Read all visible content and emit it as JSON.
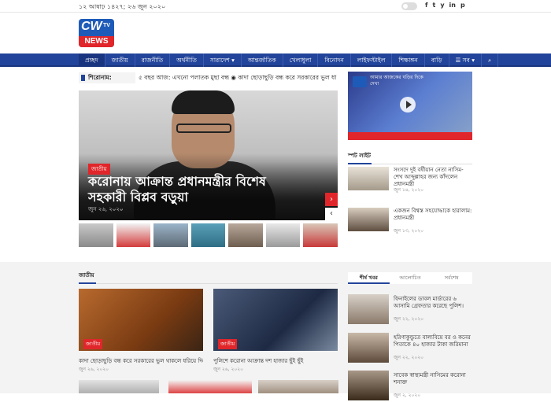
{
  "topbar": {
    "date": "১২ আষাঢ় ১৪২৭; ২৬ জুন ২০২০",
    "social": [
      "f",
      "t",
      "y",
      "in",
      "p"
    ]
  },
  "logo": {
    "cw": "CW",
    "tv": "TV",
    "news": "NEWS"
  },
  "nav": [
    "প্রচ্ছদ",
    "জাতীয়",
    "রাজনীতি",
    "অর্থনীতি",
    "সারাদেশ ▾",
    "আন্তর্জাতিক",
    "খেলাধুলা",
    "বিনোদন",
    "লাইফস্টাইল",
    "শিক্ষাঙ্গন",
    "বাড়ি",
    "☰ সব ▾",
    "⌕"
  ],
  "ticker": {
    "label": "শিরোনাম:",
    "items": "৫ বছর আজ: এখনো পলাতক মুছা বন্ধ  ◉ কাদা ছোড়াছুড়ি বন্ধ করে সরকারের ভুল ধা"
  },
  "hero": {
    "category": "জাতীয়",
    "title": "করোনায় আক্রান্ত প্রধানমন্ত্রীর বিশেষ সহকারী বিপ্লব বড়ুয়া",
    "date": "জুন ২৬, ২০২০"
  },
  "video": {
    "caption": "আমার আজকের ঘড়ির দিকে দেখা",
    "subtitle": "Cwt news"
  },
  "spotlight": {
    "heading": "স্পট লাইট",
    "items": [
      {
        "title": "সংসদে দুই বর্ষীয়ান নেতা নাসিম-শেখ আব্দুল্লাহর জন্য কাঁদলেন প্রধানমন্ত্রী",
        "date": "জুন ১৪, ২০২০"
      },
      {
        "title": "একজন বিশ্বস্ত সহযোদ্ধাকে হারালাম: প্রধানমন্ত্রী",
        "date": "জুন ১৩, ২০২০"
      }
    ]
  },
  "section": {
    "heading": "জাতীয়",
    "cards": [
      {
        "category": "জাতীয়",
        "title": "কাদা ছোড়াছুড়ি বন্ধ করে সরকারের ভুল থাকলে ধরিয়ে দিন",
        "date": "জুন ২৬, ২০২০"
      },
      {
        "category": "জাতীয়",
        "title": "পুলিশে করোনা আক্রান্ত দশ হাজার ছুঁই ছুঁই",
        "date": "জুন ২৬, ২০২০"
      }
    ]
  },
  "tabs": [
    "শীর্ষ খবর",
    "আলোচিত",
    "সর্বশেষ"
  ],
  "sidelist": [
    {
      "title": "ফিনাইলের ডাবল মার্ডারের ৬ আসামি গ্রেফতার করেছে পুলিশ।",
      "date": "জুন ২২, ২০২০"
    },
    {
      "title": "হরিণাকুন্ডুতে বাল্যবিয়ে বর ও কনের পিতাকে ৪০ হাজার টাকা জরিমানা",
      "date": "জুন ২২, ২০২০"
    },
    {
      "title": "সাবেক স্বাস্থ্যমন্ত্রী নাসিমের করোনা শনাক্ত",
      "date": "জুন ২, ২০২০"
    }
  ],
  "colors": {
    "brand": "#22449a",
    "accent": "#e0262a"
  }
}
